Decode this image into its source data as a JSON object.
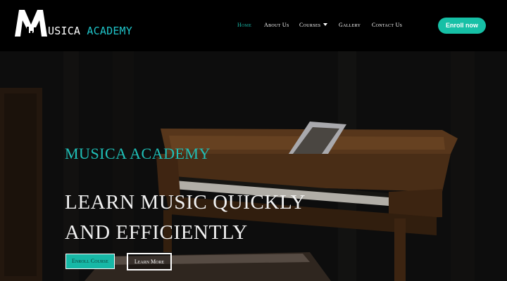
{
  "brand": {
    "logo_letter": "M",
    "logo_text": "USICA",
    "logo_accent": "ACADEMY",
    "accent_color": "#1fc4c9"
  },
  "nav": {
    "items": [
      {
        "label": "Home",
        "active": true
      },
      {
        "label": "About Us",
        "active": false
      },
      {
        "label": "Courses",
        "active": false,
        "has_dropdown": true
      },
      {
        "label": "Gallery",
        "active": false
      },
      {
        "label": "Contact Us",
        "active": false
      }
    ],
    "active_color": "#19b8a8"
  },
  "header": {
    "enroll_label": "Enroll now",
    "enroll_color": "#16c0a6"
  },
  "hero": {
    "eyebrow": "MUSICA ACADEMY",
    "headline_line1": "LEARN MUSIC QUICKLY",
    "headline_line2": "AND EFFICIENTLY",
    "primary_button": "Enroll Course",
    "secondary_button": "Learn More",
    "background_image": "piano-photo"
  }
}
